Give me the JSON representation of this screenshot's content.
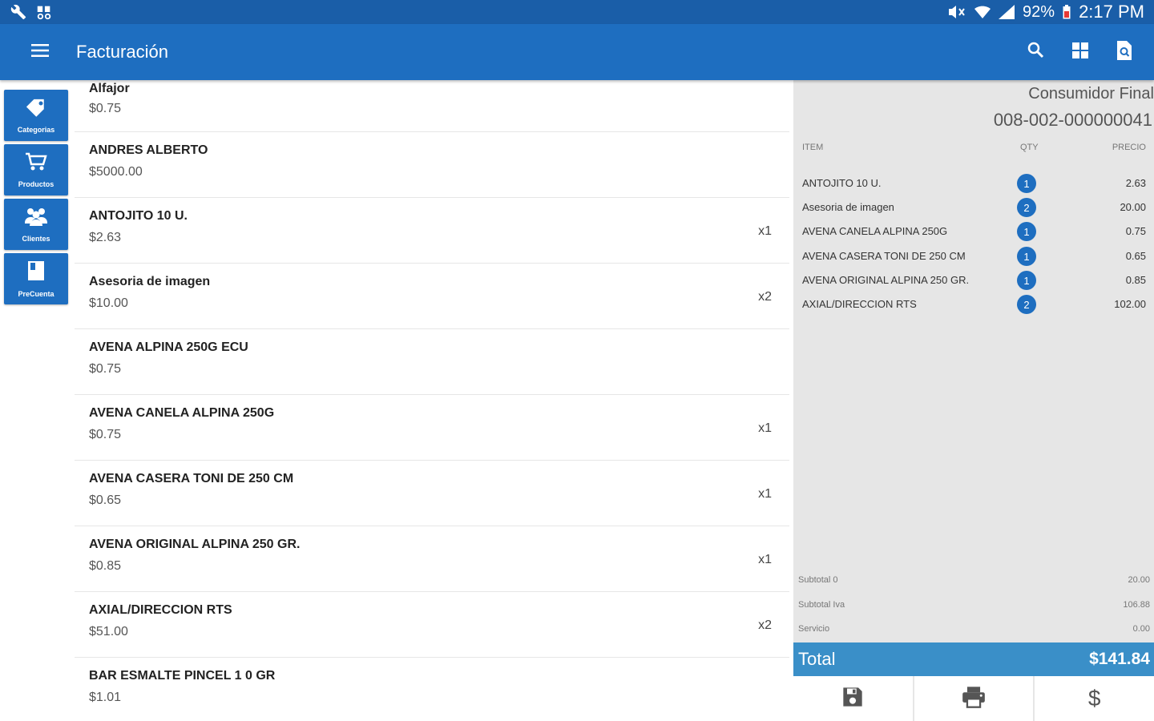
{
  "status_bar": {
    "battery": "92%",
    "time": "2:17 PM"
  },
  "app_bar": {
    "title": "Facturación"
  },
  "side_nav": [
    {
      "label": "Categorias",
      "icon": "tag-icon"
    },
    {
      "label": "Productos",
      "icon": "cart-icon"
    },
    {
      "label": "Clientes",
      "icon": "people-icon"
    },
    {
      "label": "PreCuenta",
      "icon": "book-icon"
    }
  ],
  "products": [
    {
      "name": "Alfajor",
      "price": "$0.75",
      "qty": ""
    },
    {
      "name": "ANDRES ALBERTO",
      "price": "$5000.00",
      "qty": ""
    },
    {
      "name": "ANTOJITO 10 U.",
      "price": "$2.63",
      "qty": "x1"
    },
    {
      "name": "Asesoria de imagen",
      "price": "$10.00",
      "qty": "x2"
    },
    {
      "name": "AVENA ALPINA 250G ECU",
      "price": "$0.75",
      "qty": ""
    },
    {
      "name": "AVENA CANELA ALPINA 250G",
      "price": "$0.75",
      "qty": "x1"
    },
    {
      "name": "AVENA CASERA TONI DE 250 CM",
      "price": "$0.65",
      "qty": "x1"
    },
    {
      "name": "AVENA ORIGINAL ALPINA 250 GR.",
      "price": "$0.85",
      "qty": "x1"
    },
    {
      "name": "AXIAL/DIRECCION RTS",
      "price": "$51.00",
      "qty": "x2"
    },
    {
      "name": "BAR ESMALTE PINCEL 1 0 GR",
      "price": "$1.01",
      "qty": ""
    }
  ],
  "invoice": {
    "customer": "Consumidor Final",
    "number": "008-002-000000041",
    "headers": {
      "item": "ITEM",
      "qty": "QTY",
      "price": "PRECIO"
    },
    "items": [
      {
        "name": "ANTOJITO 10 U.",
        "qty": "1",
        "price": "2.63"
      },
      {
        "name": "Asesoria de imagen",
        "qty": "2",
        "price": "20.00"
      },
      {
        "name": "AVENA CANELA ALPINA 250G",
        "qty": "1",
        "price": "0.75"
      },
      {
        "name": "AVENA CASERA TONI DE 250 CM",
        "qty": "1",
        "price": "0.65"
      },
      {
        "name": "AVENA ORIGINAL ALPINA 250 GR.",
        "qty": "1",
        "price": "0.85"
      },
      {
        "name": "AXIAL/DIRECCION RTS",
        "qty": "2",
        "price": "102.00"
      }
    ],
    "summary": [
      {
        "label": "Subtotal 0",
        "value": "20.00"
      },
      {
        "label": "Subtotal Iva",
        "value": "106.88"
      },
      {
        "label": "Servicio",
        "value": "0.00"
      }
    ],
    "total_label": "Total",
    "total_value": "$141.84",
    "actions": [
      "save-icon",
      "print-icon",
      "dollar-icon"
    ],
    "dollar_glyph": "$"
  },
  "colors": {
    "status_bar": "#1a5ea8",
    "app_bar": "#1e6ec0",
    "total_bar": "#3a8fc8",
    "panel_bg": "#e6e6e6"
  }
}
